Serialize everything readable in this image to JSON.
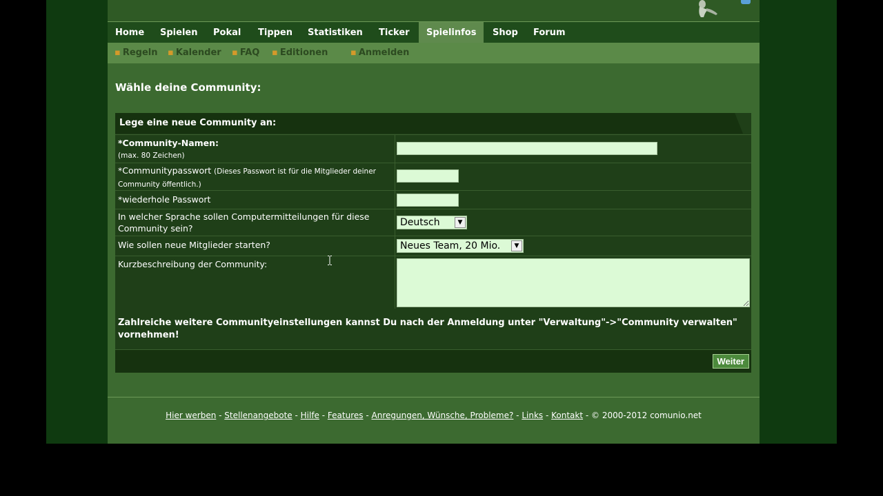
{
  "nav": {
    "items": [
      {
        "label": "Home"
      },
      {
        "label": "Spielen"
      },
      {
        "label": "Pokal"
      },
      {
        "label": "Tippen"
      },
      {
        "label": "Statistiken"
      },
      {
        "label": "Ticker"
      },
      {
        "label": "Spielinfos"
      },
      {
        "label": "Shop"
      },
      {
        "label": "Forum"
      }
    ],
    "active": "Spielinfos"
  },
  "subnav": {
    "bullet": "▪",
    "items": [
      {
        "label": "Regeln"
      },
      {
        "label": "Kalender"
      },
      {
        "label": "FAQ"
      },
      {
        "label": "Editionen"
      },
      {
        "label": "Anmelden"
      }
    ]
  },
  "page_title": "Wähle deine Community:",
  "form": {
    "header": "Lege eine neue Community an:",
    "fields": {
      "community_name": {
        "label": "*Community-Namen:",
        "hint": "(max. 80 Zeichen)",
        "value": ""
      },
      "password": {
        "label": "*Communitypasswort",
        "hint": "(Dieses Passwort ist für die Mitglieder deiner Community öffentlich.)",
        "value": ""
      },
      "password_repeat": {
        "label": "*wiederhole Passwort",
        "value": ""
      },
      "language": {
        "label": "In welcher Sprache sollen Computermitteilungen für diese Community sein?",
        "value": "Deutsch"
      },
      "start": {
        "label": "Wie sollen neue Mitglieder starten?",
        "value": "Neues Team, 20 Mio."
      },
      "description": {
        "label": "Kurzbeschreibung der Community:",
        "value": ""
      }
    },
    "info": "Zahlreiche weitere Communityeinstellungen kannst Du nach der Anmeldung unter \"Verwaltung\"->\"Community verwalten\" vornehmen!",
    "submit_label": "Weiter"
  },
  "footer": {
    "links": [
      {
        "label": "Hier werben"
      },
      {
        "label": "Stellenangebote"
      },
      {
        "label": "Hilfe"
      },
      {
        "label": "Features"
      },
      {
        "label": "Anregungen, Wünsche, Probleme?"
      },
      {
        "label": "Links"
      },
      {
        "label": "Kontakt"
      }
    ],
    "separator": " - ",
    "copyright": "© 2000-2012 comunio.net"
  },
  "colors": {
    "outer_bg": "#0f3a10",
    "page_bg": "#3c6a30",
    "nav_bg": "#1f4c1b",
    "subnav_bg": "#5b8a48",
    "bullet": "#d49a2a",
    "input_bg": "#dcfad6"
  },
  "icons": {
    "dropdown": "chevron-down-icon",
    "logo": "player-figure-icon"
  }
}
